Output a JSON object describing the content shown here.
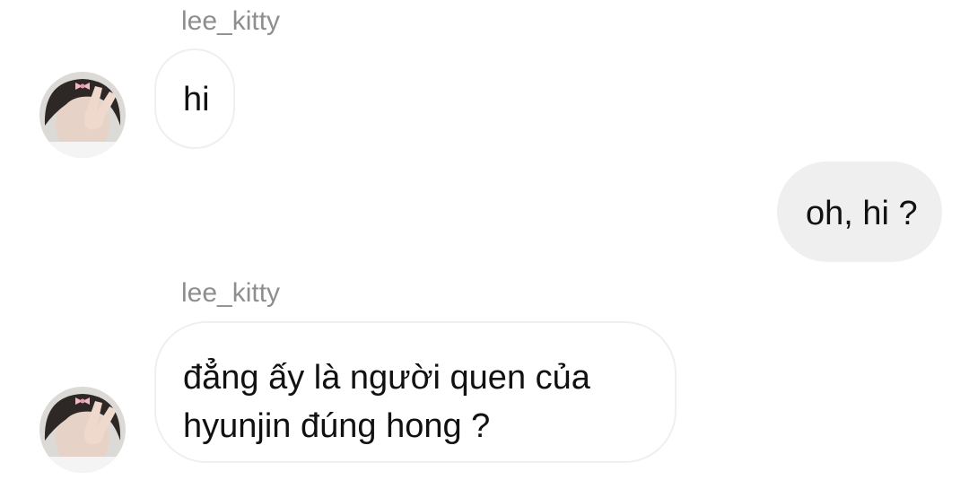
{
  "messages": [
    {
      "sender": "lee_kitty",
      "direction": "incoming",
      "text": "hi"
    },
    {
      "direction": "outgoing",
      "text": "oh, hi ?"
    },
    {
      "sender": "lee_kitty",
      "direction": "incoming",
      "lines": [
        "đẳng ấy là người quen của",
        "hyunjin đúng hong ?"
      ]
    }
  ],
  "colors": {
    "incoming_bubble_bg": "#ffffff",
    "incoming_bubble_border": "#efefef",
    "outgoing_bubble_bg": "#efefef",
    "sender_name": "#8e8e8e",
    "message_text": "#111111"
  },
  "icons": {
    "avatar": "profile-photo"
  }
}
